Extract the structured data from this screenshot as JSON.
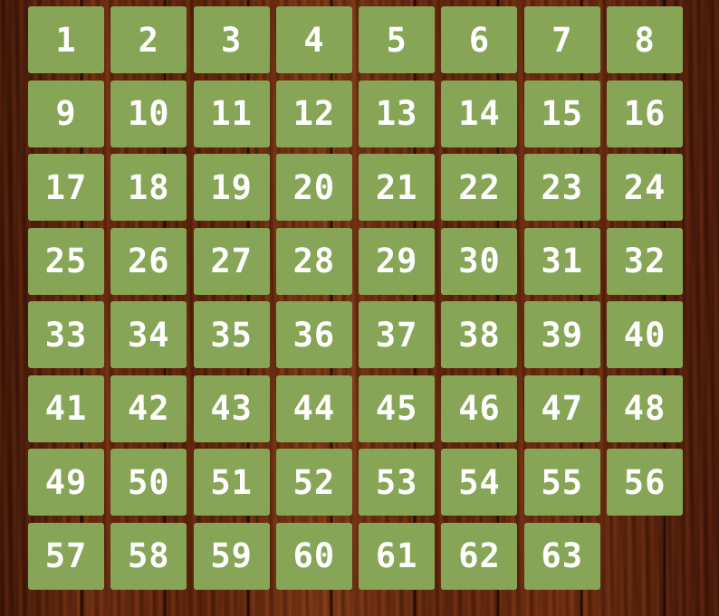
{
  "board": {
    "tile_color": "#86a556",
    "text_color": "#ffffff",
    "background_color": "#5a230c",
    "tiles": [
      "1",
      "2",
      "3",
      "4",
      "5",
      "6",
      "7",
      "8",
      "9",
      "10",
      "11",
      "12",
      "13",
      "14",
      "15",
      "16",
      "17",
      "18",
      "19",
      "20",
      "21",
      "22",
      "23",
      "24",
      "25",
      "26",
      "27",
      "28",
      "29",
      "30",
      "31",
      "32",
      "33",
      "34",
      "35",
      "36",
      "37",
      "38",
      "39",
      "40",
      "41",
      "42",
      "43",
      "44",
      "45",
      "46",
      "47",
      "48",
      "49",
      "50",
      "51",
      "52",
      "53",
      "54",
      "55",
      "56",
      "57",
      "58",
      "59",
      "60",
      "61",
      "62",
      "63"
    ]
  }
}
